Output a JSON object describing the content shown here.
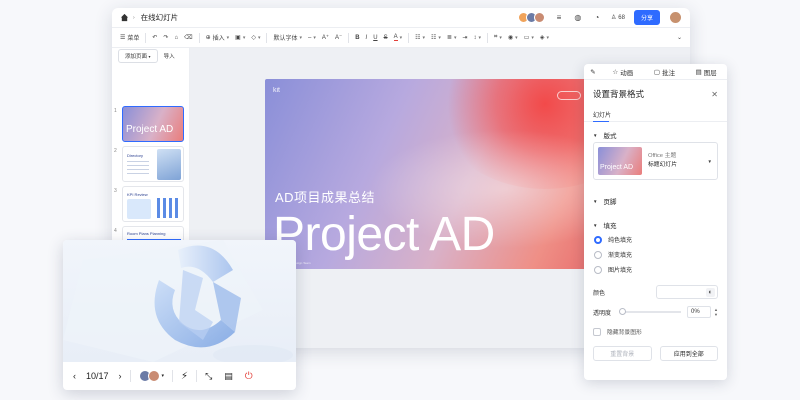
{
  "app": {
    "title": "在线幻灯片",
    "share_label": "分享",
    "user_label": "68"
  },
  "toolbar": {
    "menu_label": "菜单",
    "insert_label": "插入",
    "font_label": "默认字体",
    "items": [
      "undo-icon",
      "redo-icon",
      "format-painter-icon",
      "clear-format-icon",
      "image-icon",
      "shape-icon",
      "font-size-up-icon",
      "font-size-down-icon",
      "bold-icon",
      "italic-icon",
      "underline-icon",
      "strikethrough-icon",
      "font-color-icon",
      "bullet-list-icon",
      "numbered-list-icon",
      "align-icon",
      "indent-icon",
      "line-spacing-icon",
      "text-box-icon",
      "more-icon"
    ]
  },
  "slides_panel": {
    "add_page_label": "添加页面",
    "import_label": "导入",
    "thumbs": [
      {
        "num": "1",
        "title": "Project AD"
      },
      {
        "num": "2",
        "title": "Directory"
      },
      {
        "num": "3",
        "title": "KPI Review"
      },
      {
        "num": "4",
        "title": "Room Plans Planning"
      },
      {
        "num": "5",
        "title": ""
      }
    ]
  },
  "slide": {
    "brand": "kit",
    "subtitle": "AD项目成果总结",
    "title": "Project AD",
    "footer": "Design Team"
  },
  "format_panel": {
    "tabs": [
      {
        "label": "",
        "icon": "format-icon"
      },
      {
        "label": "动画",
        "icon": "animation-icon"
      },
      {
        "label": "批注",
        "icon": "comment-icon"
      },
      {
        "label": "图层",
        "icon": "layer-icon"
      }
    ],
    "heading": "设置背景格式",
    "subtab": "幻灯片",
    "layout_section": "版式",
    "layout_theme": "Office 主题",
    "layout_name": "标题幻灯片",
    "layout_thumb_title": "Project AD",
    "footer_section": "页脚",
    "fill_section": "填充",
    "fill_options": [
      {
        "label": "纯色填充",
        "selected": true
      },
      {
        "label": "渐变填充",
        "selected": false
      },
      {
        "label": "图片填充",
        "selected": false
      }
    ],
    "color_label": "颜色",
    "opacity_label": "透明度",
    "opacity_value": "0%",
    "hide_bg_label": "隐藏背景图形",
    "reset_label": "重置背景",
    "apply_all_label": "应用到全部"
  },
  "presenter": {
    "page": "10/17"
  },
  "colors": {
    "accent": "#2f6bff",
    "slide_start": "#8a8fd8",
    "slide_end": "#e86f6e"
  }
}
